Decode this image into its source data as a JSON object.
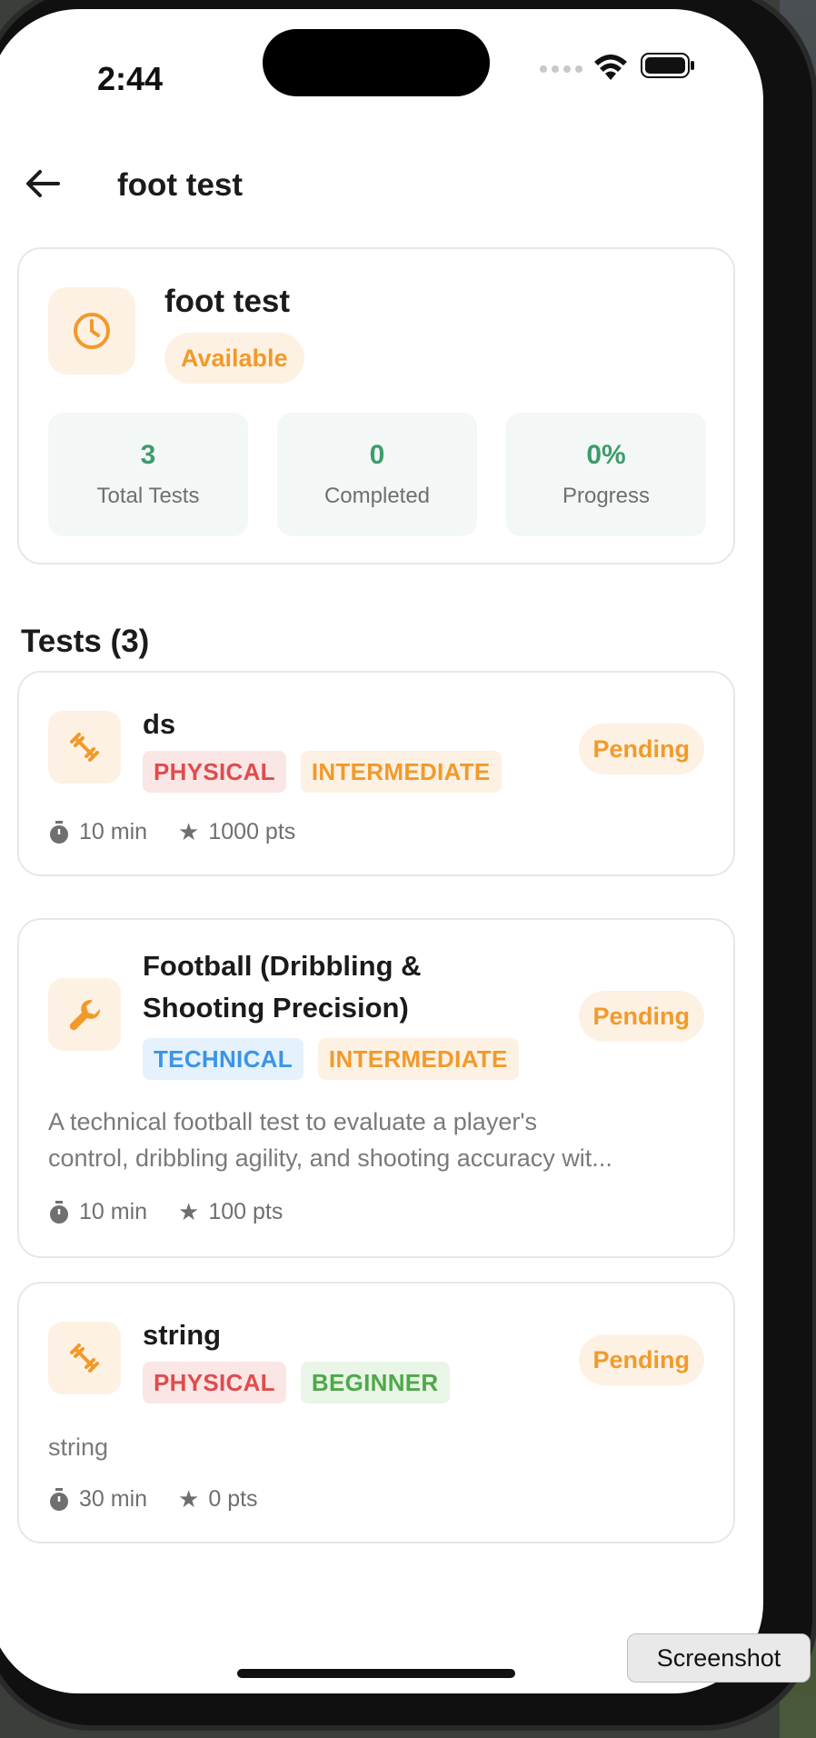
{
  "status_bar": {
    "time": "2:44"
  },
  "header": {
    "title": "foot test"
  },
  "summary": {
    "name": "foot test",
    "status": "Available",
    "stats": [
      {
        "value": "3",
        "label": "Total Tests"
      },
      {
        "value": "0",
        "label": "Completed"
      },
      {
        "value": "0%",
        "label": "Progress"
      }
    ]
  },
  "tests_section": {
    "title": "Tests (3)"
  },
  "tests": [
    {
      "name": "ds",
      "status": "Pending",
      "icon": "dumbbell-icon",
      "tags": [
        "PHYSICAL",
        "INTERMEDIATE"
      ],
      "description": "",
      "duration": "10 min",
      "points": "1000 pts"
    },
    {
      "name_line1": "Football (Dribbling &",
      "name_line2": "Shooting Precision)",
      "status": "Pending",
      "icon": "wrench-icon",
      "tags": [
        "TECHNICAL",
        "INTERMEDIATE"
      ],
      "description_line1": "A technical football test to evaluate a player's",
      "description_line2": "control, dribbling agility, and shooting accuracy wit...",
      "duration": "10 min",
      "points": "100 pts"
    },
    {
      "name": "string",
      "status": "Pending",
      "icon": "dumbbell-icon",
      "tags": [
        "PHYSICAL",
        "BEGINNER"
      ],
      "description": "string",
      "duration": "30 min",
      "points": "0 pts"
    }
  ],
  "tooltip": {
    "label": "Screenshot"
  },
  "colors": {
    "accent_orange": "#f19a2b",
    "success_green": "#3e9b6b",
    "physical_red": "#df4c4c",
    "technical_blue": "#3a95e6",
    "beginner_green": "#4fa84a"
  }
}
